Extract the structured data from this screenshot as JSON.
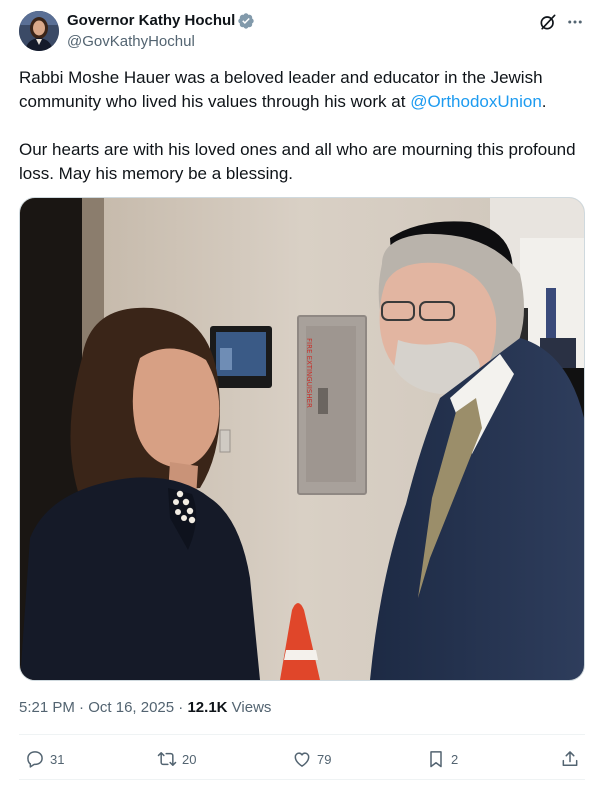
{
  "author": {
    "name": "Governor Kathy Hochul",
    "handle": "@GovKathyHochul",
    "verified": true
  },
  "tweet": {
    "paragraph1_before": "Rabbi Moshe Hauer was a beloved leader and educator in the Jewish community who lived his values through his work at ",
    "mention": "@OrthodoxUnion",
    "paragraph1_after": ".",
    "paragraph2": "Our hearts are with his loved ones and all who are mourning this profound loss. May his memory be a blessing."
  },
  "photo": {
    "panel_text": "FIRE EXTINGUISHER"
  },
  "meta": {
    "time": "5:21 PM",
    "separator": " · ",
    "date": "Oct 16, 2025",
    "views_count": "12.1K",
    "views_label": " Views"
  },
  "actions": {
    "replies": "31",
    "reposts": "20",
    "likes": "79",
    "bookmarks": "2"
  },
  "icons": [
    "grok-icon",
    "more-icon",
    "verified-badge-icon",
    "reply-icon",
    "repost-icon",
    "like-icon",
    "bookmark-icon",
    "share-icon"
  ],
  "colors": {
    "accent": "#1d9bf0",
    "text": "#0f1419",
    "secondary": "#536471"
  }
}
